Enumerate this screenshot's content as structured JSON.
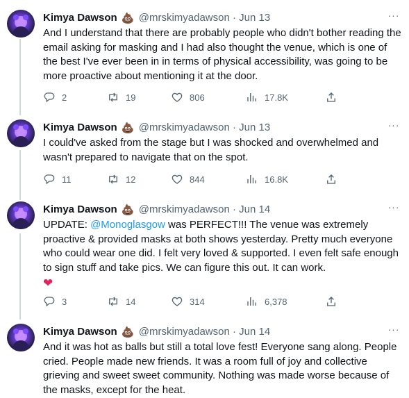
{
  "tweets": [
    {
      "name": "Kimya Dawson",
      "emoji": "💩",
      "handle": "@mrskimyadawson",
      "separator": "·",
      "date": "Jun 13",
      "more": "···",
      "text": "And I understand that there are probably people who didn't bother reading the email asking for masking and I had also thought the venue, which is one of the best I've ever been in in terms of physical accessibility, was going to be more proactive about mentioning it at the door.",
      "replies": "2",
      "retweets": "19",
      "likes": "806",
      "views": "17.8K"
    },
    {
      "name": "Kimya Dawson",
      "emoji": "💩",
      "handle": "@mrskimyadawson",
      "separator": "·",
      "date": "Jun 13",
      "more": "···",
      "text": "I could've asked from the stage but I was shocked and overwhelmed and wasn't prepared to navigate that on the spot.",
      "replies": "11",
      "retweets": "12",
      "likes": "844",
      "views": "16.8K"
    },
    {
      "name": "Kimya Dawson",
      "emoji": "💩",
      "handle": "@mrskimyadawson",
      "separator": "·",
      "date": "Jun 14",
      "more": "···",
      "text_prefix": "UPDATE: ",
      "mention": "@Monoglasgow",
      "text": " was PERFECT!!! The venue was extremely proactive & provided masks at both shows yesterday. Pretty much everyone who could wear one did. I felt very loved & supported. I even felt safe enough to sign stuff and take pics. We can figure this out. It can work.",
      "heart": "❤",
      "replies": "3",
      "retweets": "14",
      "likes": "314",
      "views": "6,378"
    },
    {
      "name": "Kimya Dawson",
      "emoji": "💩",
      "handle": "@mrskimyadawson",
      "separator": "·",
      "date": "Jun 14",
      "more": "···",
      "text": "And it was hot as balls but still a total love fest! Everyone sang along. People cried. People made new friends. It was a room full of joy and collective grieving and sweet sweet community. Nothing was made worse because of the masks, except for the heat."
    }
  ],
  "colors": {
    "text": "#0f1419",
    "secondary": "#536471",
    "link": "#1d9bf0",
    "thread_line": "#cfd9de",
    "heart": "#e0245e"
  }
}
